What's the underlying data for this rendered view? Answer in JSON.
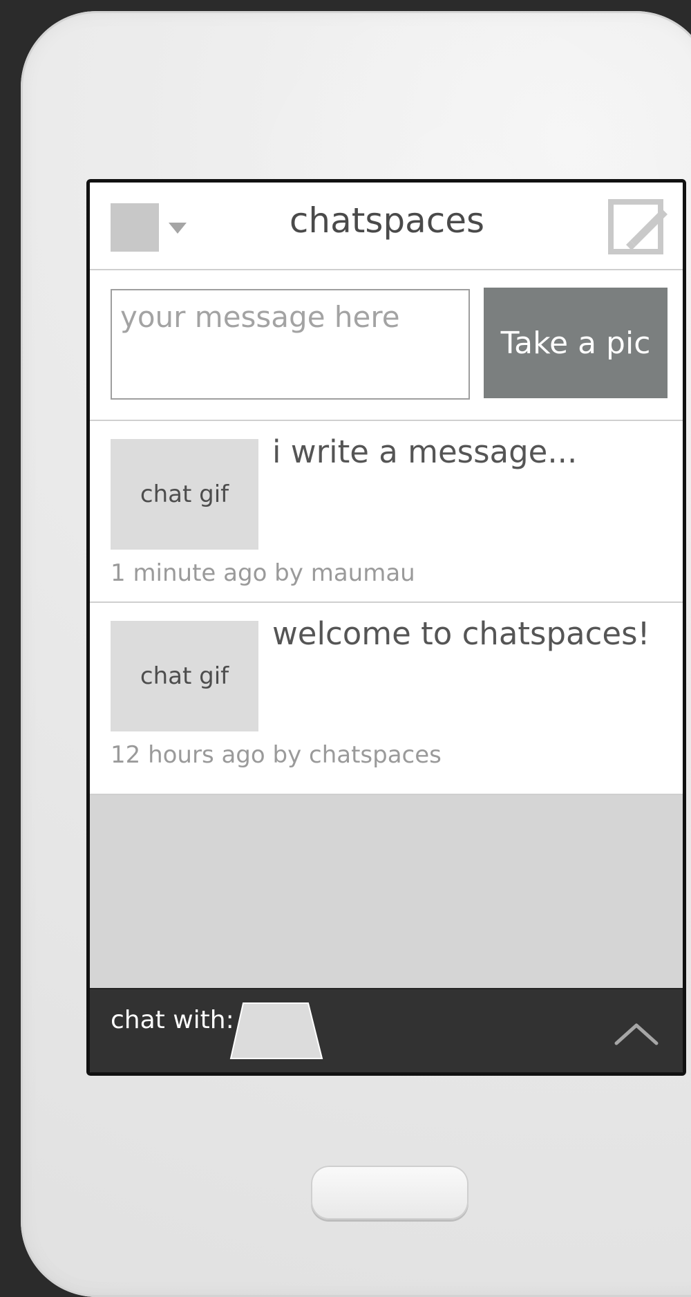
{
  "header": {
    "title": "chatspaces"
  },
  "composer": {
    "placeholder": "your message here",
    "button_label": "Take a pic"
  },
  "messages": [
    {
      "gif_label": "chat gif",
      "text": "i write a message...",
      "meta": "1 minute ago by maumau"
    },
    {
      "gif_label": "chat gif",
      "text": "welcome to chatspaces!",
      "meta": "12 hours ago by chatspaces"
    }
  ],
  "footer": {
    "chat_with_label": "chat with:"
  },
  "icons": {
    "compose": "compose-icon",
    "caret": "chevron-down-icon",
    "expand": "chevron-up-icon"
  },
  "colors": {
    "screen_bg": "#d5d5d5",
    "button_bg": "#7b7f7f",
    "footer_bg": "#323232"
  }
}
